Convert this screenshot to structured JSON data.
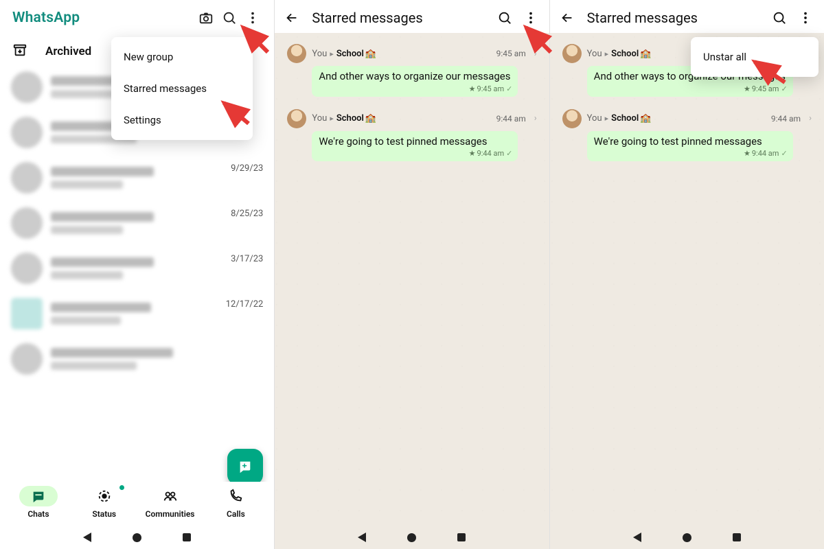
{
  "app": {
    "title": "WhatsApp"
  },
  "archived_label": "Archived",
  "menu": {
    "new_group": "New group",
    "starred": "Starred messages",
    "settings": "Settings"
  },
  "chat_dates": [
    "",
    "",
    "9/29/23",
    "8/25/23",
    "3/17/23",
    "12/17/22",
    ""
  ],
  "bottom_nav": {
    "chats": "Chats",
    "status": "Status",
    "communities": "Communities",
    "calls": "Calls"
  },
  "starred": {
    "title": "Starred messages",
    "you": "You",
    "school": "School",
    "m1": {
      "text": "And other ways to organize our messages",
      "time": "9:45 am",
      "top_time": "9:45 am"
    },
    "m2": {
      "text": "We're going to test pinned messages",
      "time": "9:44 am",
      "top_time": "9:44 am"
    }
  },
  "unstar_label": "Unstar all"
}
